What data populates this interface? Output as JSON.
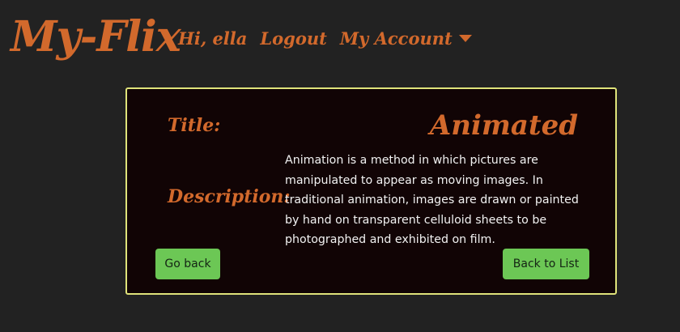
{
  "navbar": {
    "brand": "My-Flix",
    "greeting": "Hi, ella",
    "logout": "Logout",
    "account": "My Account"
  },
  "genre": {
    "title_label": "Title:",
    "title_value": "Animated",
    "description_label": "Description:",
    "description_value": "Animation is a method in which pictures are manipulated to appear as moving images. In traditional animation, images are drawn or painted by hand on transparent celluloid sheets to be photographed and exhibited on film."
  },
  "actions": {
    "go_back": "Go back",
    "back_to_list": "Back to List"
  },
  "colors": {
    "background": "#222222",
    "accent": "#d2692c",
    "card_background": "#110405",
    "card_border": "#dfe37a",
    "button": "#6cc755"
  }
}
